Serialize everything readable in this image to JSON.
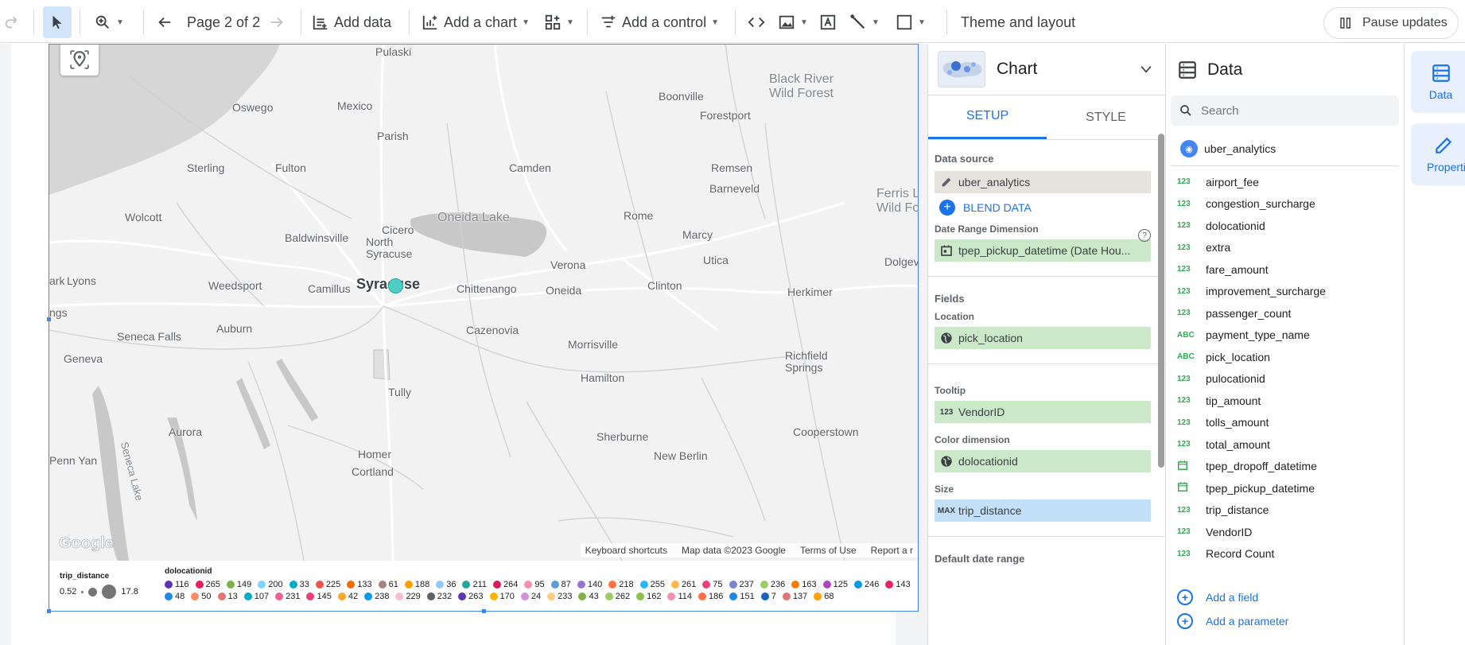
{
  "toolbar": {
    "page_indicator": "Page 2 of 2",
    "add_data": "Add data",
    "add_chart": "Add a chart",
    "add_control": "Add a control",
    "theme_layout": "Theme and layout",
    "pause_updates": "Pause updates"
  },
  "map": {
    "places": [
      {
        "name": "Pulaski",
        "style": "normal"
      },
      {
        "name": "Oswego",
        "style": "normal"
      },
      {
        "name": "Mexico",
        "style": "normal"
      },
      {
        "name": "Boonville",
        "style": "normal"
      },
      {
        "name": "Black River Wild Forest",
        "style": "muted"
      },
      {
        "name": "Forestport",
        "style": "normal"
      },
      {
        "name": "Parish",
        "style": "normal"
      },
      {
        "name": "Sterling",
        "style": "normal"
      },
      {
        "name": "Fulton",
        "style": "normal"
      },
      {
        "name": "Camden",
        "style": "normal"
      },
      {
        "name": "Remsen",
        "style": "normal"
      },
      {
        "name": "Barneveld",
        "style": "normal"
      },
      {
        "name": "Ferris L Wild Fo",
        "style": "muted"
      },
      {
        "name": "Wolcott",
        "style": "normal"
      },
      {
        "name": "Oneida Lake",
        "style": "muted"
      },
      {
        "name": "Rome",
        "style": "normal"
      },
      {
        "name": "Baldwinsville",
        "style": "normal"
      },
      {
        "name": "Cicero",
        "style": "normal"
      },
      {
        "name": "North Syracuse",
        "style": "normal"
      },
      {
        "name": "Marcy",
        "style": "normal"
      },
      {
        "name": "Verona",
        "style": "normal"
      },
      {
        "name": "Utica",
        "style": "normal"
      },
      {
        "name": "Dolgeville",
        "style": "normal"
      },
      {
        "name": "Lyons",
        "style": "normal"
      },
      {
        "name": "Weedsport",
        "style": "normal"
      },
      {
        "name": "Camillus",
        "style": "normal"
      },
      {
        "name": "Syracuse",
        "style": "big"
      },
      {
        "name": "Chittenango",
        "style": "normal"
      },
      {
        "name": "Oneida",
        "style": "normal"
      },
      {
        "name": "Clinton",
        "style": "normal"
      },
      {
        "name": "Herkimer",
        "style": "normal"
      },
      {
        "name": "Seneca Falls",
        "style": "normal"
      },
      {
        "name": "Auburn",
        "style": "normal"
      },
      {
        "name": "Cazenovia",
        "style": "normal"
      },
      {
        "name": "Morrisville",
        "style": "normal"
      },
      {
        "name": "Richfield Springs",
        "style": "normal"
      },
      {
        "name": "Geneva",
        "style": "normal"
      },
      {
        "name": "Hamilton",
        "style": "normal"
      },
      {
        "name": "Tully",
        "style": "normal"
      },
      {
        "name": "Aurora",
        "style": "normal"
      },
      {
        "name": "Cooperstown",
        "style": "normal"
      },
      {
        "name": "Sherburne",
        "style": "normal"
      },
      {
        "name": "Penn Yan",
        "style": "normal"
      },
      {
        "name": "Homer",
        "style": "normal"
      },
      {
        "name": "New Berlin",
        "style": "normal"
      },
      {
        "name": "Cortland",
        "style": "normal"
      },
      {
        "name": "Seneca Lake",
        "style": "muted"
      },
      {
        "name": "ark",
        "style": "normal"
      },
      {
        "name": "ngs",
        "style": "normal"
      }
    ],
    "attribution": [
      "Keyboard shortcuts",
      "Map data ©2023 Google",
      "Terms of Use",
      "Report a r"
    ],
    "google_logo": "Google",
    "point_color": "#4ecdc4"
  },
  "legend": {
    "size_title": "trip_distance",
    "size_min": "0.52",
    "size_max": "17.8",
    "color_title": "dolocationid",
    "items": [
      {
        "v": "116",
        "c": "#5e35b1"
      },
      {
        "v": "265",
        "c": "#e91e63"
      },
      {
        "v": "149",
        "c": "#7cb342"
      },
      {
        "v": "200",
        "c": "#81d4fa"
      },
      {
        "v": "33",
        "c": "#00acc1"
      },
      {
        "v": "225",
        "c": "#ef5350"
      },
      {
        "v": "133",
        "c": "#ef6c00"
      },
      {
        "v": "61",
        "c": "#a1887f"
      },
      {
        "v": "188",
        "c": "#ffa000"
      },
      {
        "v": "36",
        "c": "#90caf9"
      },
      {
        "v": "211",
        "c": "#26a69a"
      },
      {
        "v": "264",
        "c": "#d81b60"
      },
      {
        "v": "95",
        "c": "#f48fb1"
      },
      {
        "v": "87",
        "c": "#5c9bd5"
      },
      {
        "v": "140",
        "c": "#9575cd"
      },
      {
        "v": "218",
        "c": "#ff7043"
      },
      {
        "v": "255",
        "c": "#29b6f6"
      },
      {
        "v": "261",
        "c": "#ffb74d"
      },
      {
        "v": "75",
        "c": "#ec407a"
      },
      {
        "v": "237",
        "c": "#7986cb"
      },
      {
        "v": "236",
        "c": "#9ccc65"
      },
      {
        "v": "163",
        "c": "#f57c00"
      },
      {
        "v": "125",
        "c": "#ab47bc"
      },
      {
        "v": "246",
        "c": "#039be5"
      },
      {
        "v": "143",
        "c": "#e91e63"
      },
      {
        "v": "48",
        "c": "#1e88e5"
      },
      {
        "v": "50",
        "c": "#ff8a65"
      },
      {
        "v": "13",
        "c": "#e57373"
      },
      {
        "v": "107",
        "c": "#00acc1"
      },
      {
        "v": "231",
        "c": "#f06292"
      },
      {
        "v": "145",
        "c": "#ec407a"
      },
      {
        "v": "42",
        "c": "#ffa726"
      },
      {
        "v": "238",
        "c": "#039be5"
      },
      {
        "v": "229",
        "c": "#f8bbd0"
      },
      {
        "v": "232",
        "c": "#616161"
      },
      {
        "v": "263",
        "c": "#5e35b1"
      },
      {
        "v": "170",
        "c": "#ffb300"
      },
      {
        "v": "24",
        "c": "#ce93d8"
      },
      {
        "v": "233",
        "c": "#ffcc80"
      },
      {
        "v": "43",
        "c": "#7cb342"
      },
      {
        "v": "262",
        "c": "#9ccc65"
      },
      {
        "v": "162",
        "c": "#8bc34a"
      },
      {
        "v": "114",
        "c": "#f48fb1"
      },
      {
        "v": "186",
        "c": "#ff7043"
      },
      {
        "v": "151",
        "c": "#1e88e5"
      },
      {
        "v": "7",
        "c": "#1565c0"
      },
      {
        "v": "137",
        "c": "#e57373"
      },
      {
        "v": "68",
        "c": "#ffa000"
      }
    ]
  },
  "chart_panel": {
    "title": "Chart",
    "tabs": [
      "SETUP",
      "STYLE"
    ],
    "data_source_label": "Data source",
    "data_source_value": "uber_analytics",
    "blend_data": "BLEND DATA",
    "date_range_dim_label": "Date Range Dimension",
    "date_range_dim_value": "tpep_pickup_datetime (Date Hou...",
    "fields_label": "Fields",
    "location_label": "Location",
    "location_value": "pick_location",
    "tooltip_label": "Tooltip",
    "tooltip_type": "123",
    "tooltip_value": "VendorID",
    "color_dim_label": "Color dimension",
    "color_dim_value": "dolocationid",
    "size_label": "Size",
    "size_type": "MAX",
    "size_value": "trip_distance",
    "default_date_range": "Default date range"
  },
  "data_panel": {
    "title": "Data",
    "search_placeholder": "Search",
    "source": "uber_analytics",
    "fields": [
      {
        "type": "123",
        "name": "airport_fee"
      },
      {
        "type": "123",
        "name": "congestion_surcharge"
      },
      {
        "type": "123",
        "name": "dolocationid"
      },
      {
        "type": "123",
        "name": "extra"
      },
      {
        "type": "123",
        "name": "fare_amount"
      },
      {
        "type": "123",
        "name": "improvement_surcharge"
      },
      {
        "type": "123",
        "name": "passenger_count"
      },
      {
        "type": "ABC",
        "name": "payment_type_name"
      },
      {
        "type": "ABC",
        "name": "pick_location"
      },
      {
        "type": "123",
        "name": "pulocationid"
      },
      {
        "type": "123",
        "name": "tip_amount"
      },
      {
        "type": "123",
        "name": "tolls_amount"
      },
      {
        "type": "123",
        "name": "total_amount"
      },
      {
        "type": "date",
        "name": "tpep_dropoff_datetime"
      },
      {
        "type": "date",
        "name": "tpep_pickup_datetime"
      },
      {
        "type": "123",
        "name": "trip_distance"
      },
      {
        "type": "123",
        "name": "VendorID"
      },
      {
        "type": "123",
        "name": "Record Count"
      }
    ],
    "add_field": "Add a field",
    "add_parameter": "Add a parameter"
  },
  "side_tabs": {
    "data": "Data",
    "properties": "Properties"
  }
}
